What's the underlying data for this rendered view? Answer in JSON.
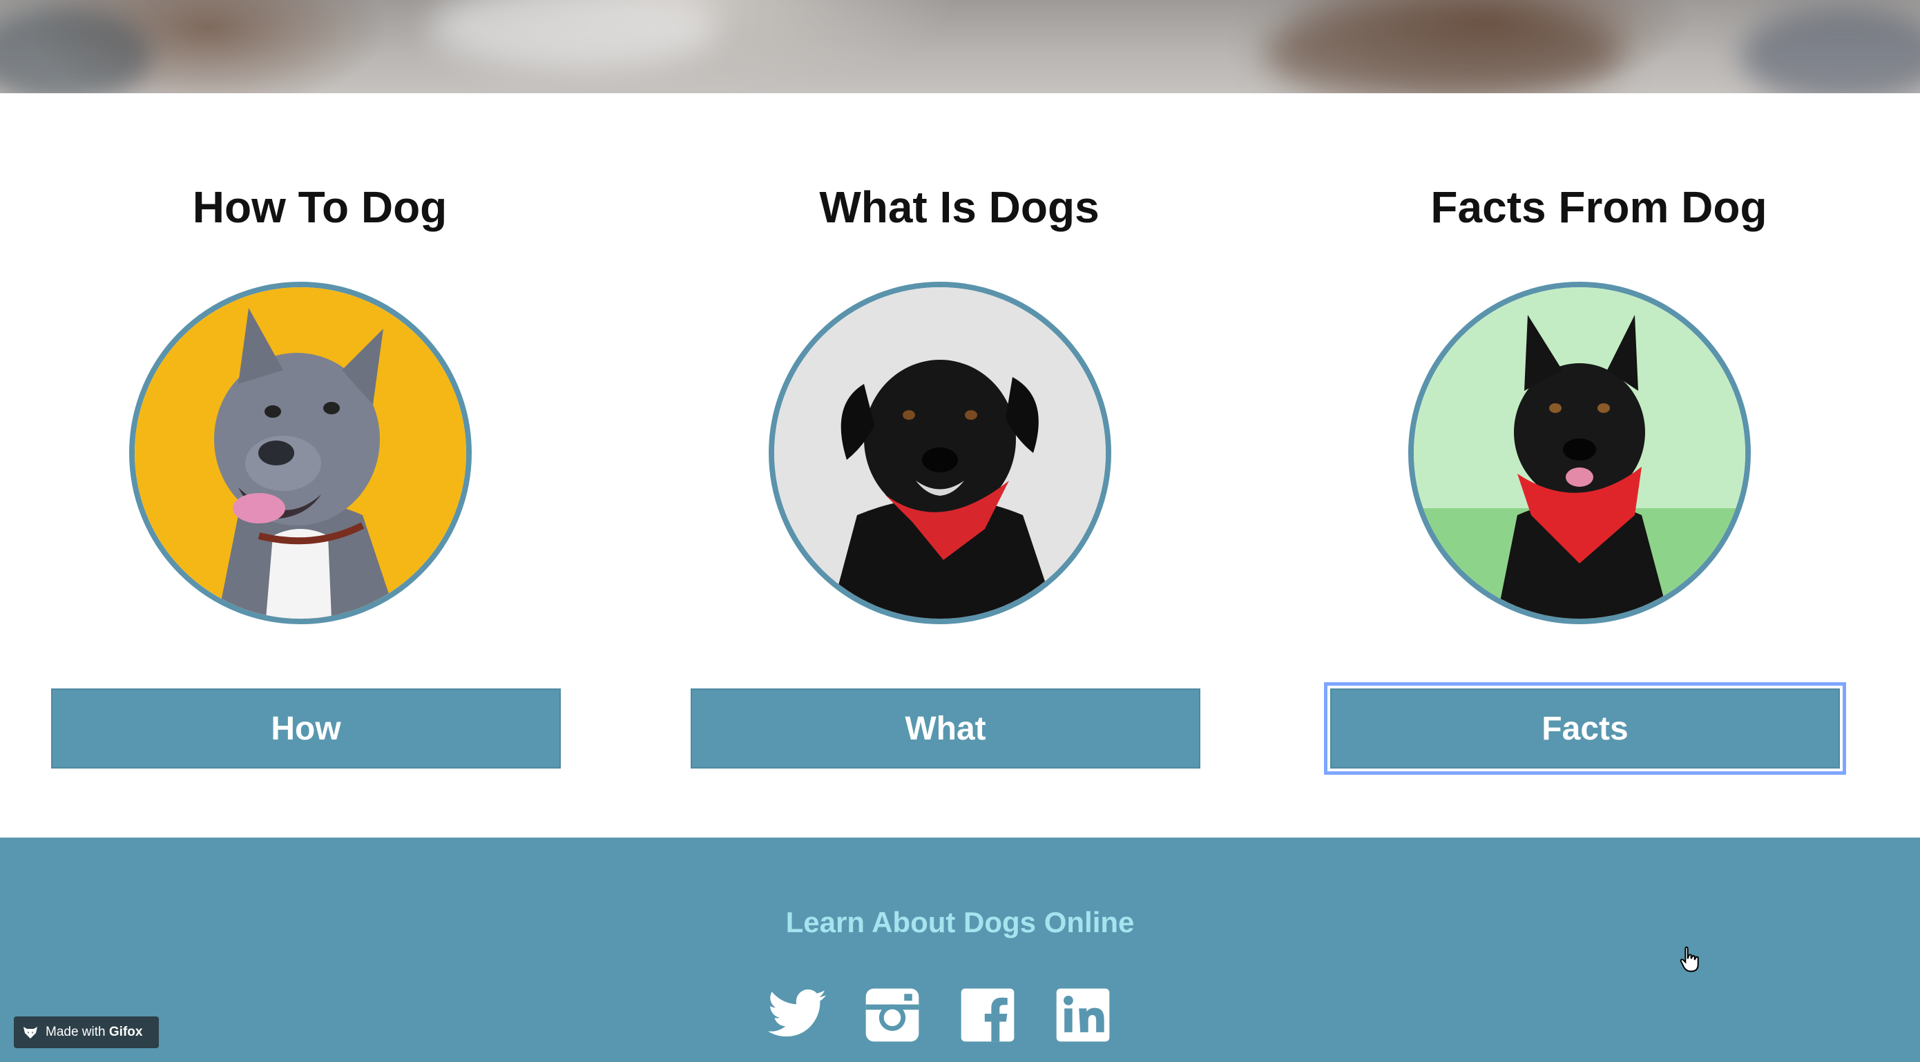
{
  "cards": [
    {
      "title": "How To Dog",
      "button": "How",
      "photo": "grey-pitbull-on-yellow",
      "bg": "#f5b716"
    },
    {
      "title": "What Is Dogs",
      "button": "What",
      "photo": "black-dog-red-bandana-on-grey",
      "bg": "#e6e6e6"
    },
    {
      "title": "Facts From Dog",
      "button": "Facts",
      "photo": "black-dog-red-bandana-on-green",
      "bg": "#bfe8bf"
    }
  ],
  "footer": {
    "title": "Learn About Dogs Online",
    "socials": [
      "twitter-icon",
      "instagram-icon",
      "facebook-icon",
      "linkedin-icon"
    ]
  },
  "badge": {
    "prefix": "Made with",
    "brand": "Gifox"
  },
  "colors": {
    "accent": "#5897af",
    "footer_text": "#a6e3ef",
    "focus_ring": "#7ea6ff"
  }
}
